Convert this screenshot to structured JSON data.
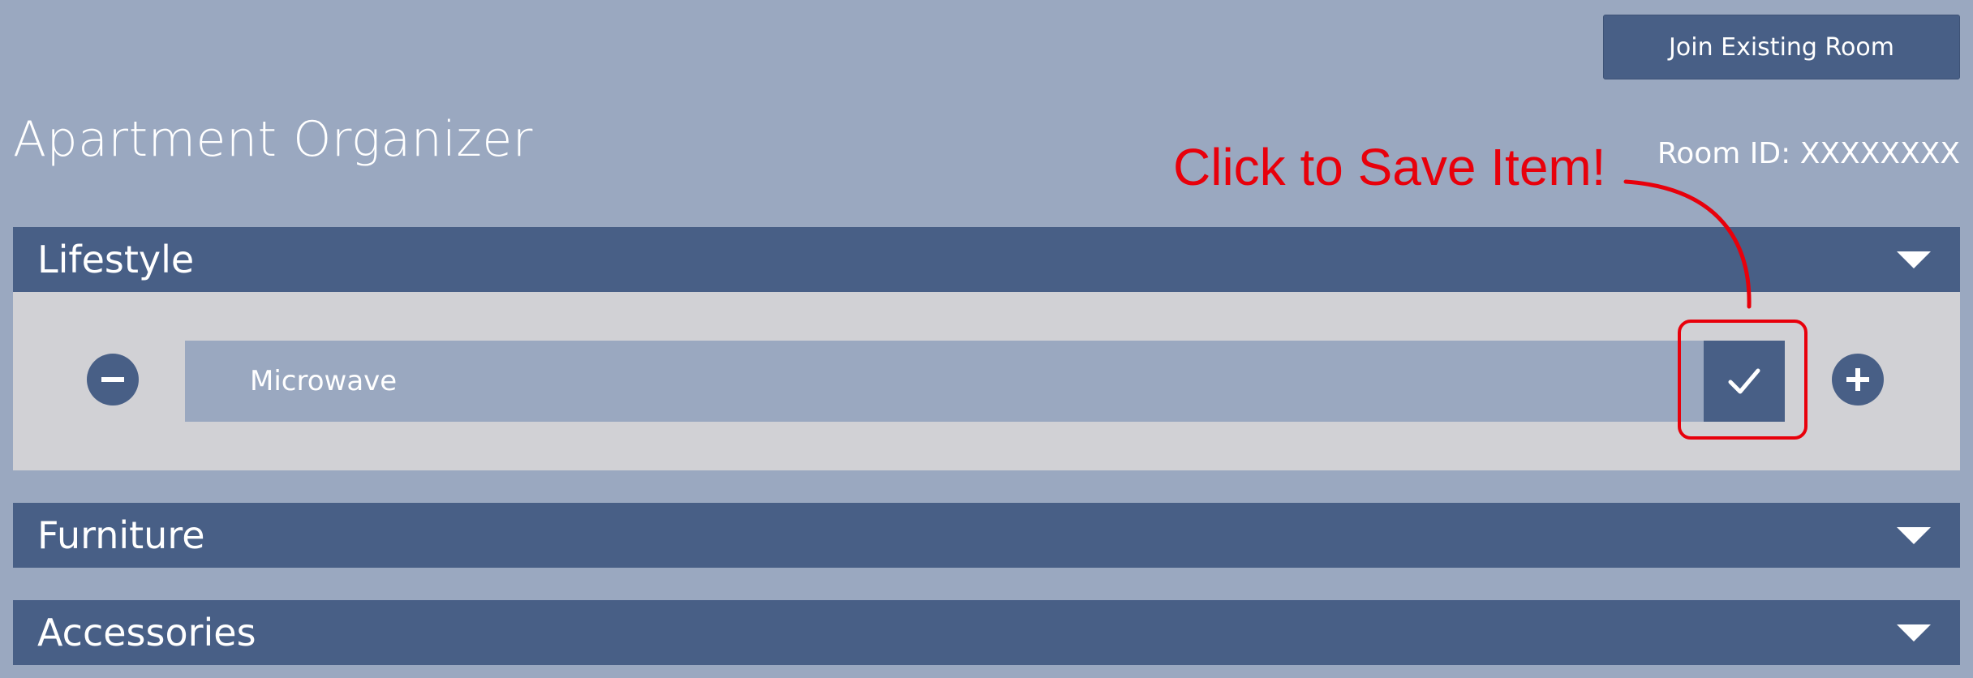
{
  "header": {
    "join_button_label": "Join Existing Room",
    "app_title": "Apartment Organizer",
    "room_id_label": "Room ID: XXXXXXXX"
  },
  "annotation": {
    "text": "Click to Save Item!",
    "color": "#e8000b"
  },
  "sections": [
    {
      "label": "Lifestyle",
      "expanded": true,
      "items": [
        {
          "value": "Microwave"
        }
      ]
    },
    {
      "label": "Furniture",
      "expanded": false
    },
    {
      "label": "Accessories",
      "expanded": false
    }
  ],
  "icons": {
    "remove": "minus-circle-icon",
    "save": "checkmark-icon",
    "add": "plus-circle-icon",
    "expand": "chevron-down-icon"
  },
  "colors": {
    "background": "#9aa8c0",
    "primary": "#485f86",
    "panel": "#d1d1d5",
    "annotation": "#e8000b",
    "text": "#ffffff"
  }
}
